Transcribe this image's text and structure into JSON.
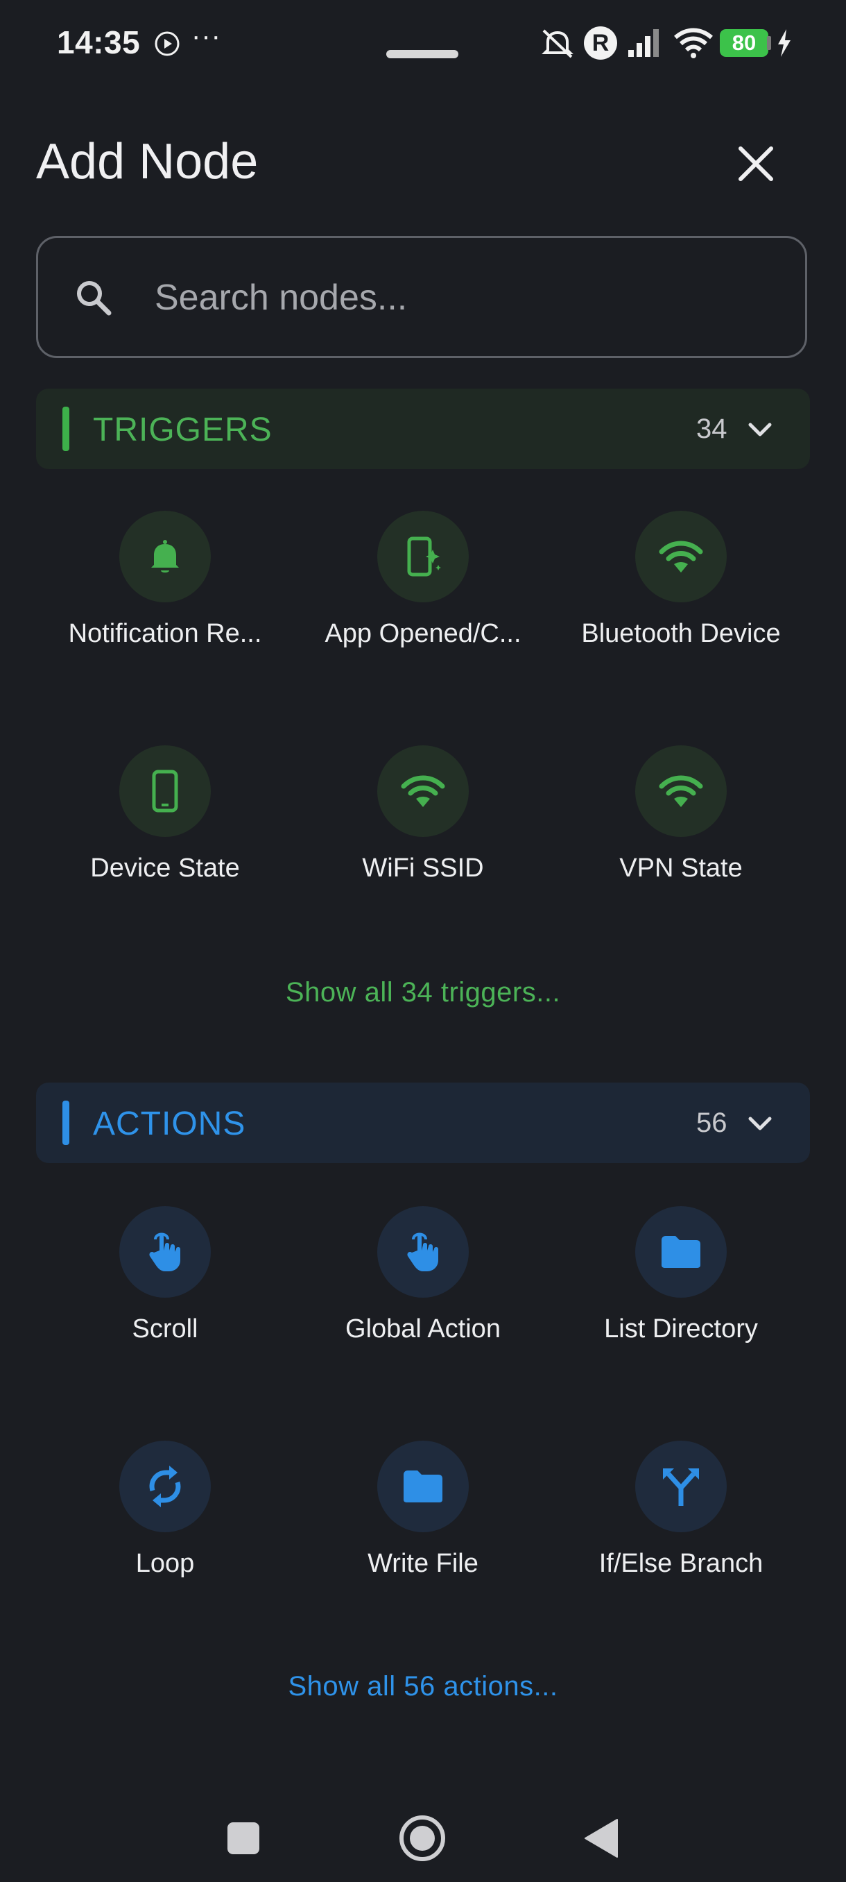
{
  "status_bar": {
    "time": "14:35",
    "overflow": "···",
    "battery": "80"
  },
  "header": {
    "title": "Add Node"
  },
  "search": {
    "placeholder": "Search nodes..."
  },
  "triggers": {
    "label": "TRIGGERS",
    "count": "34",
    "color": "#4cb357",
    "items": [
      {
        "name": "Notification Re...",
        "icon": "bell-icon"
      },
      {
        "name": "App Opened/C...",
        "icon": "app-sparkle-icon"
      },
      {
        "name": "Bluetooth Device",
        "icon": "wifi-icon"
      },
      {
        "name": "Device State",
        "icon": "phone-icon"
      },
      {
        "name": "WiFi SSID",
        "icon": "wifi-icon"
      },
      {
        "name": "VPN State",
        "icon": "wifi-icon"
      }
    ],
    "show_all": "Show all 34 triggers..."
  },
  "actions": {
    "label": "ACTIONS",
    "count": "56",
    "color": "#2f93ea",
    "items": [
      {
        "name": "Scroll",
        "icon": "touch-icon"
      },
      {
        "name": "Global Action",
        "icon": "touch-icon"
      },
      {
        "name": "List Directory",
        "icon": "folder-icon"
      },
      {
        "name": "Loop",
        "icon": "loop-icon"
      },
      {
        "name": "Write File",
        "icon": "folder-icon"
      },
      {
        "name": "If/Else Branch",
        "icon": "branch-icon"
      }
    ],
    "show_all": "Show all 56 actions..."
  }
}
